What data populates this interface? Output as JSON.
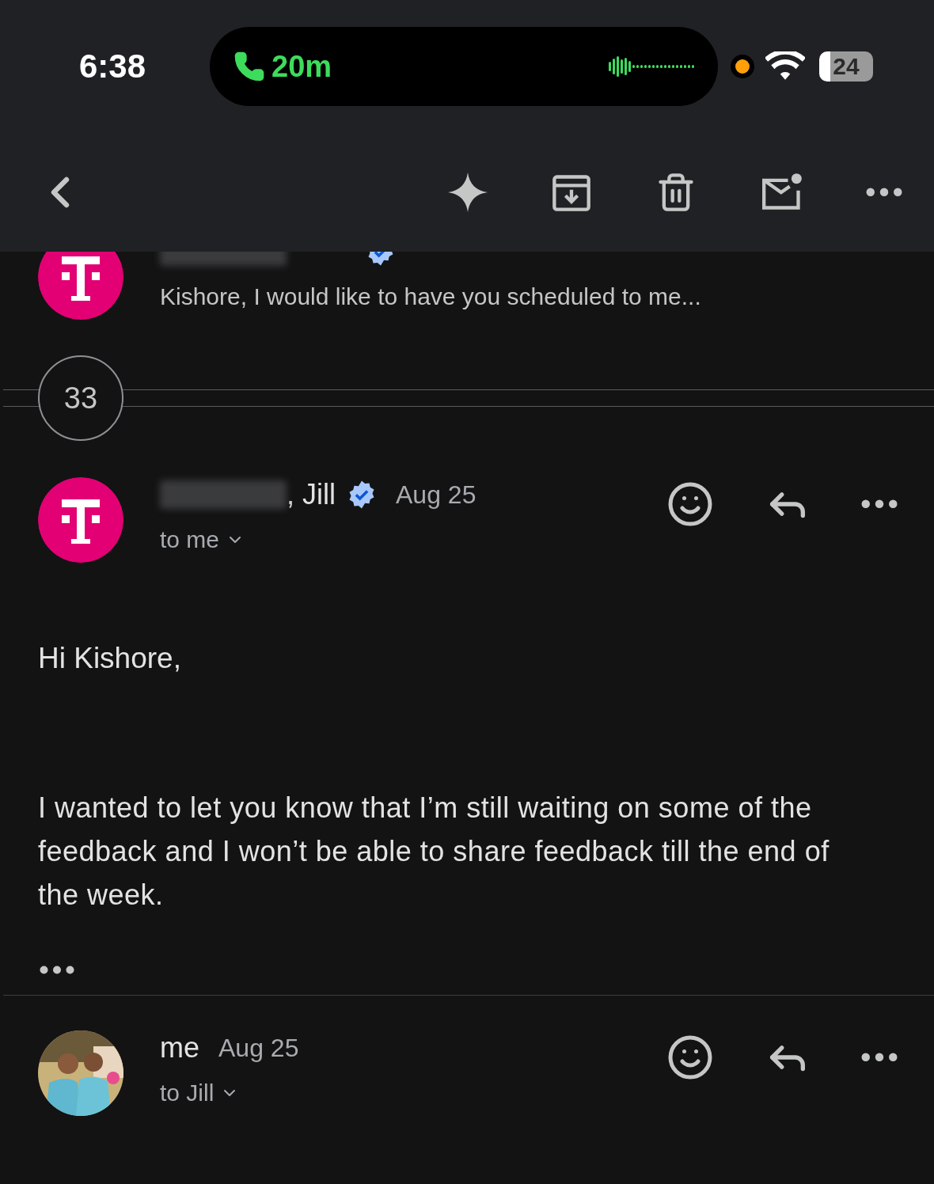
{
  "status_bar": {
    "time": "6:38",
    "call_duration": "20m",
    "battery": "24"
  },
  "messages": [
    {
      "kind": "collapsed",
      "avatar": {
        "kind": "logo"
      },
      "verified": true,
      "snippet": "Kishore, I would like to have you scheduled to me..."
    },
    {
      "kind": "count",
      "count": "33"
    },
    {
      "kind": "expanded",
      "avatar": {
        "kind": "logo"
      },
      "sender": ", Jill",
      "verified": true,
      "date": "Aug 25",
      "recipients": "to me",
      "greeting": "Hi Kishore,",
      "body": "I wanted to let you know that I’m still waiting on some of the feedback and I won’t be able to share feedback till the end of the week."
    },
    {
      "kind": "header",
      "sender": "me",
      "date": "Aug 25",
      "recipients": "to Jill"
    }
  ]
}
